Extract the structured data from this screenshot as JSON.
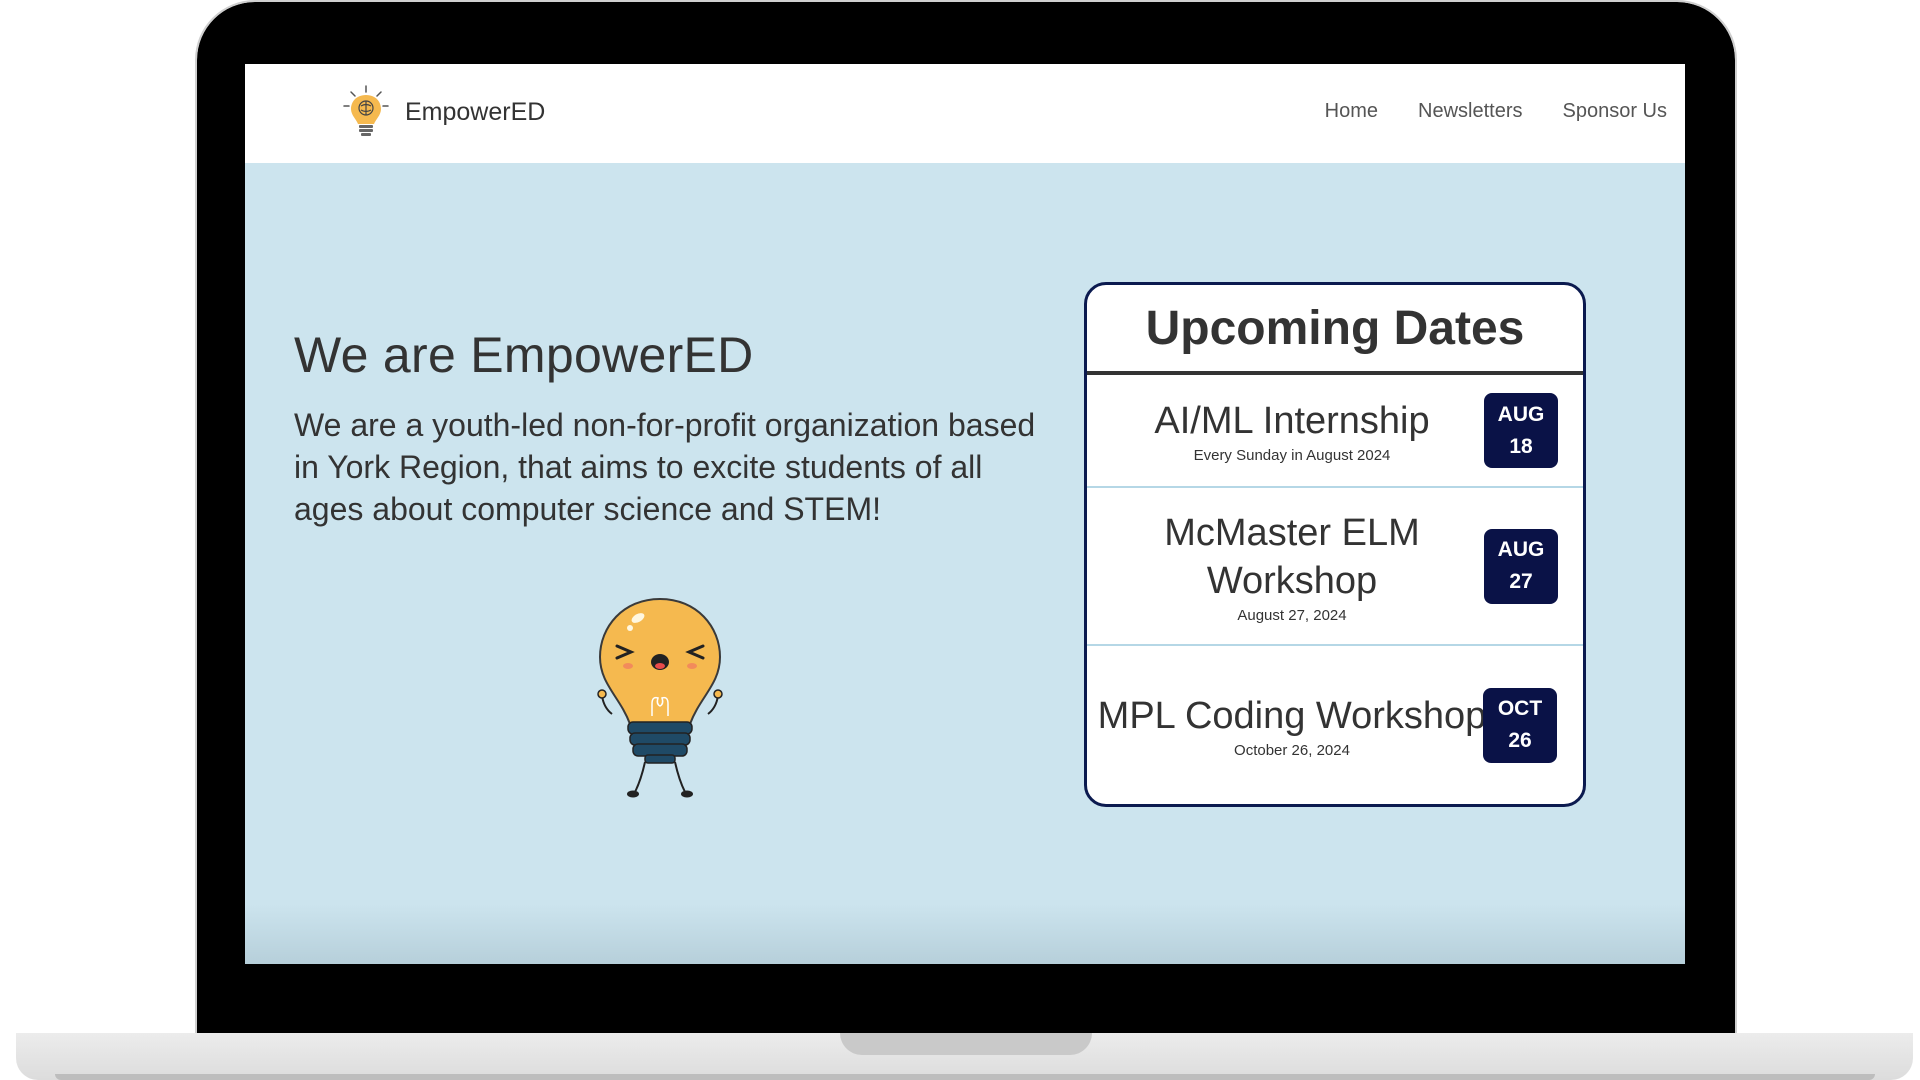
{
  "nav": {
    "brand": "EmpowerED",
    "links": [
      "Home",
      "Newsletters",
      "Sponsor Us"
    ]
  },
  "hero": {
    "title": "We are EmpowerED",
    "text": "We are a youth-led non-for-profit organization based in York Region, that aims to excite students of all ages about computer science and STEM!"
  },
  "upcoming": {
    "title": "Upcoming Dates",
    "events": [
      {
        "name": "AI/ML Internship",
        "sub": "Every Sunday in August 2024",
        "month": "AUG",
        "day": "18"
      },
      {
        "name": "McMaster ELM Workshop",
        "sub": "August 27, 2024",
        "month": "AUG",
        "day": "27"
      },
      {
        "name": "MPL Coding Workshop",
        "sub": "October 26, 2024",
        "month": "OCT",
        "day": "26"
      }
    ]
  },
  "colors": {
    "screen_bg": "#cce4ee",
    "card_border": "#0b1a4f",
    "badge_bg": "#0a1247",
    "bulb": "#f5b94f",
    "bulb_base": "#1f4a66"
  },
  "icons": {
    "brand_logo": "lightbulb-brain-icon",
    "mascot": "happy-lightbulb-mascot"
  }
}
